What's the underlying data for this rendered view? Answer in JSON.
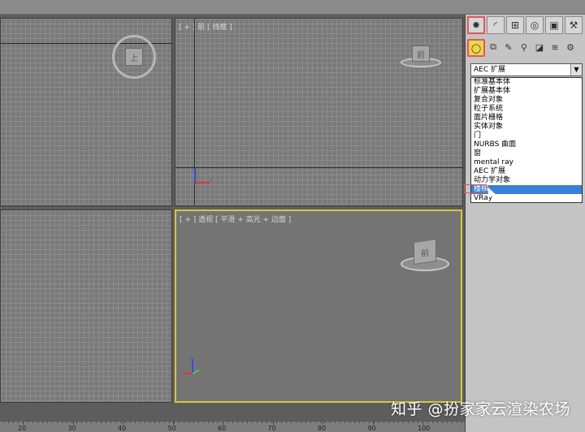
{
  "viewports": {
    "front_label": "[ + ] 前 [ 线框 ]",
    "persp_label": "[ + ] 透视 [ 平滑 + 高光 + 边面 ]",
    "top_cube_label": "上",
    "front_cube_label": "前",
    "persp_cube_label": "前"
  },
  "ruler": {
    "labels": [
      "20",
      "30",
      "40",
      "50",
      "60",
      "70",
      "80",
      "90",
      "100"
    ]
  },
  "command_panel": {
    "tabs": [
      "create-icon",
      "modify-icon",
      "hierarchy-icon",
      "motion-icon",
      "display-icon",
      "utilities-icon"
    ],
    "tab_glyphs": [
      "✹",
      "◜",
      "⊞",
      "◎",
      "▣",
      "⚒"
    ],
    "subcategories": [
      "geometry-icon",
      "shapes-icon",
      "lights-icon",
      "cameras-icon",
      "helpers-icon",
      "spacewarps-icon",
      "systems-icon"
    ],
    "sub_glyphs": [
      "◯",
      "⧉",
      "✎",
      "⚲",
      "◪",
      "≋",
      "⚙"
    ],
    "combo_value": "AEC 扩展",
    "dropdown_items": [
      "标准基本体",
      "扩展基本体",
      "复合对象",
      "粒子系统",
      "面片栅格",
      "实体对象",
      "门",
      "NURBS 曲面",
      "窗",
      "mental ray",
      "AEC 扩展",
      "动力学对象",
      "楼梯",
      "VRay"
    ],
    "selected_index": 12
  },
  "watermark": "知乎 @扮家家云渲染农场",
  "colors": {
    "active_viewport_border": "#d8c73a",
    "selection_highlight": "#3a7fd8",
    "annotation_red": "#e05858"
  }
}
